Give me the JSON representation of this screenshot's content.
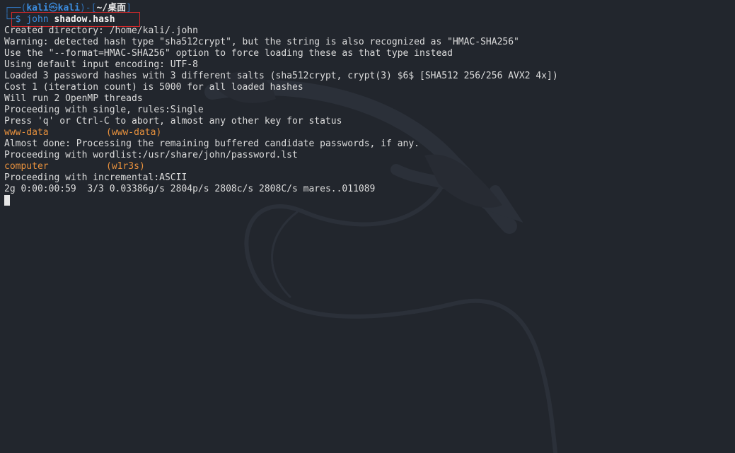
{
  "prompt": {
    "frame_top": "┌──(",
    "user": "kali",
    "at": "㉿",
    "host": "kali",
    "mid": ")-[",
    "dir": "~/桌面",
    "close": "]",
    "frame_bottom": "└─",
    "symbol": "$",
    "command": "john",
    "argument": "shadow.hash"
  },
  "output": [
    "Created directory: /home/kali/.john",
    "Warning: detected hash type \"sha512crypt\", but the string is also recognized as \"HMAC-SHA256\"",
    "Use the \"--format=HMAC-SHA256\" option to force loading these as that type instead",
    "Using default input encoding: UTF-8",
    "Loaded 3 password hashes with 3 different salts (sha512crypt, crypt(3) $6$ [SHA512 256/256 AVX2 4x])",
    "Cost 1 (iteration count) is 5000 for all loaded hashes",
    "Will run 2 OpenMP threads",
    "Proceeding with single, rules:Single",
    "Press 'q' or Ctrl-C to abort, almost any other key for status"
  ],
  "cracked1": {
    "password": "www-data",
    "user": "(www-data)"
  },
  "output2": [
    "Almost done: Processing the remaining buffered candidate passwords, if any.",
    "Proceeding with wordlist:/usr/share/john/password.lst"
  ],
  "cracked2": {
    "password": "computer",
    "user": "(w1r3s)"
  },
  "output3": [
    "Proceeding with incremental:ASCII",
    "2g 0:00:00:59  3/3 0.03386g/s 2804p/s 2808c/s 2808C/s mares..011089"
  ],
  "colors": {
    "background": "#22262d",
    "prompt_blue": "#3c8de0",
    "password_orange": "#e8913d",
    "highlight_red": "#d0282a"
  }
}
